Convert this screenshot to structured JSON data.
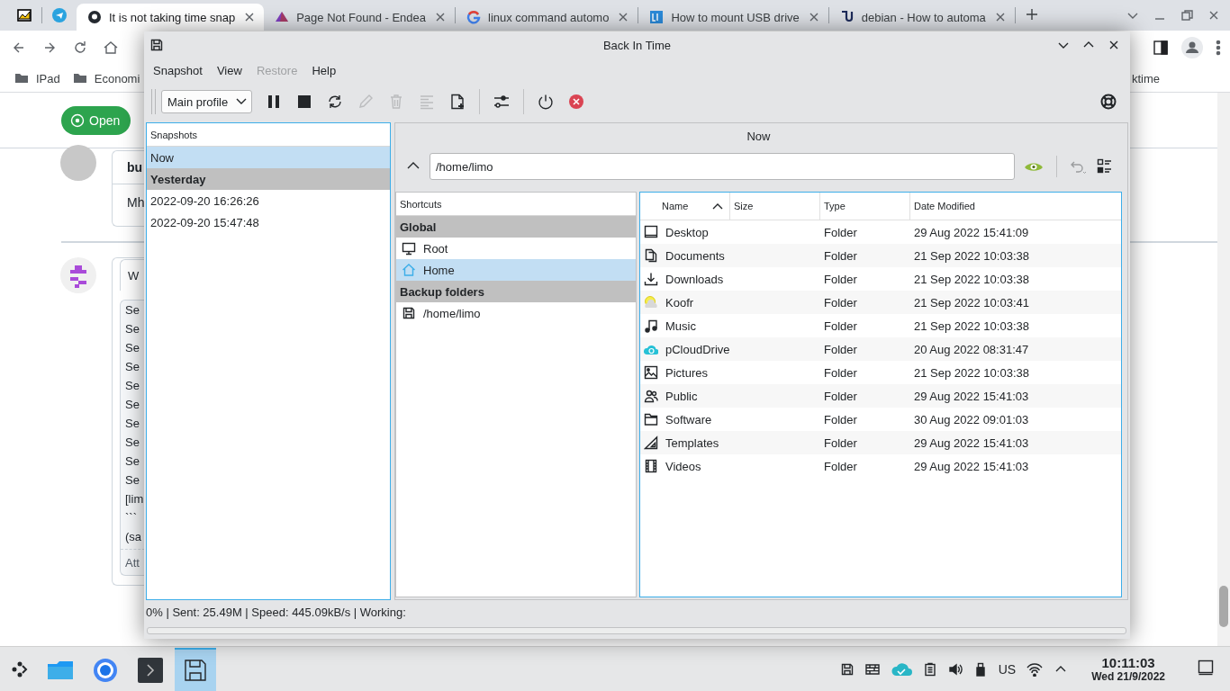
{
  "browser": {
    "tabs": [
      {
        "title": "It is not taking time snap",
        "selected": true
      },
      {
        "title": "Page Not Found - Endea",
        "selected": false
      },
      {
        "title": "linux command automo",
        "selected": false
      },
      {
        "title": "How to mount USB drive",
        "selected": false
      },
      {
        "title": "debian - How to automa",
        "selected": false
      }
    ],
    "bookmarks": [
      "IPad",
      "Economi"
    ],
    "bookmark_right": "ktime",
    "page": {
      "status_button": "Open",
      "comment_1": {
        "author": "bu",
        "text": "Mh"
      },
      "comment_2": {
        "tab": "W",
        "lines": [
          "Se",
          "Se",
          "Se",
          "Se",
          "Se",
          "Se",
          "Se",
          "Se",
          "Se",
          "Se",
          "[lim",
          "```",
          "(sa"
        ],
        "footer": "Att"
      }
    }
  },
  "window": {
    "title": "Back In Time"
  },
  "menu": [
    {
      "label": "Snapshot",
      "disabled": false
    },
    {
      "label": "View",
      "disabled": false
    },
    {
      "label": "Restore",
      "disabled": true
    },
    {
      "label": "Help",
      "disabled": false
    }
  ],
  "toolbar": {
    "profile": "Main profile",
    "buttons": [
      {
        "kind": "pause",
        "disabled": false
      },
      {
        "kind": "stop",
        "disabled": false
      },
      {
        "kind": "refresh",
        "disabled": false
      },
      {
        "kind": "edit",
        "disabled": true
      },
      {
        "kind": "delete",
        "disabled": true
      },
      {
        "kind": "log",
        "disabled": true
      },
      {
        "kind": "add",
        "disabled": false
      },
      {
        "kind": "separator"
      },
      {
        "kind": "settings",
        "disabled": false
      },
      {
        "kind": "separator"
      },
      {
        "kind": "power",
        "disabled": false
      },
      {
        "kind": "cancel",
        "disabled": false
      },
      {
        "kind": "help",
        "disabled": false
      }
    ]
  },
  "snapshots": {
    "header": "Snapshots",
    "items": [
      {
        "kind": "item",
        "label": "Now",
        "selected": true
      },
      {
        "kind": "group",
        "label": "Yesterday",
        "selected": false
      },
      {
        "kind": "item",
        "label": "2022-09-20 16:26:26",
        "selected": false
      },
      {
        "kind": "item",
        "label": "2022-09-20 15:47:48",
        "selected": false
      }
    ]
  },
  "location": {
    "title": "Now",
    "path": "/home/limo"
  },
  "shortcuts": {
    "header": "Shortcuts",
    "items": [
      {
        "kind": "group",
        "label": "Global",
        "selected": false
      },
      {
        "kind": "item",
        "label": "Root",
        "selected": false
      },
      {
        "kind": "item",
        "label": "Home",
        "selected": true
      },
      {
        "kind": "group",
        "label": "Backup folders",
        "selected": false
      },
      {
        "kind": "item",
        "label": "/home/limo",
        "selected": false
      }
    ]
  },
  "files": {
    "columns": [
      {
        "label": "Name",
        "sorted": true
      },
      {
        "label": "Size",
        "sorted": false
      },
      {
        "label": "Type",
        "sorted": false
      },
      {
        "label": "Date Modified",
        "sorted": false
      }
    ],
    "rows": [
      {
        "name": "Desktop",
        "type": "Folder",
        "date": "29 Aug 2022 15:41:09"
      },
      {
        "name": "Documents",
        "type": "Folder",
        "date": "21 Sep 2022 10:03:38"
      },
      {
        "name": "Downloads",
        "type": "Folder",
        "date": "21 Sep 2022 10:03:38"
      },
      {
        "name": "Koofr",
        "type": "Folder",
        "date": "21 Sep 2022 10:03:41"
      },
      {
        "name": "Music",
        "type": "Folder",
        "date": "21 Sep 2022 10:03:38"
      },
      {
        "name": "pCloudDrive",
        "type": "Folder",
        "date": "20 Aug 2022 08:31:47"
      },
      {
        "name": "Pictures",
        "type": "Folder",
        "date": "21 Sep 2022 10:03:38"
      },
      {
        "name": "Public",
        "type": "Folder",
        "date": "29 Aug 2022 15:41:03"
      },
      {
        "name": "Software",
        "type": "Folder",
        "date": "30 Aug 2022 09:01:03"
      },
      {
        "name": "Templates",
        "type": "Folder",
        "date": "29 Aug 2022 15:41:03"
      },
      {
        "name": "Videos",
        "type": "Folder",
        "date": "29 Aug 2022 15:41:03"
      }
    ]
  },
  "status_bar": "0% | Sent: 25.49M | Speed: 445.09kB/s | Working:",
  "progress": {
    "level": 0
  },
  "taskbar": {
    "tasks": [
      {
        "selected": false
      },
      {
        "selected": false
      },
      {
        "selected": false
      },
      {
        "selected": true
      }
    ],
    "keyboard_layout": "US",
    "time": "10:11:03",
    "date": "Wed 21/9/2022"
  }
}
